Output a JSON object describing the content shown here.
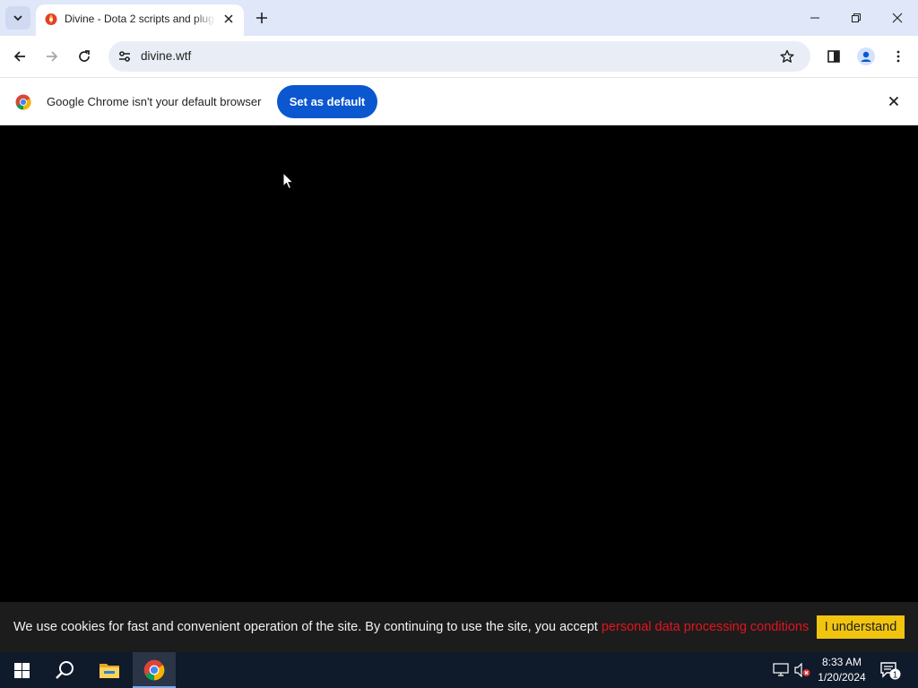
{
  "browser": {
    "tab": {
      "title": "Divine - Dota 2 scripts and plugins",
      "favicon": "divine-flame-icon"
    },
    "url": "divine.wtf",
    "infobar": {
      "message": "Google Chrome isn't your default browser",
      "button_label": "Set as default"
    }
  },
  "cookie_banner": {
    "text": "We use cookies for fast and convenient operation of the site. By continuing to use the site, you accept ",
    "link_text": "personal data processing conditions",
    "accept_label": "I understand"
  },
  "taskbar": {
    "time": "8:33 AM",
    "date": "1/20/2024",
    "notification_count": "1"
  },
  "colors": {
    "accent": "#0b57d0",
    "cookie_link": "#e3141d",
    "accept_button": "#f1c40f"
  }
}
